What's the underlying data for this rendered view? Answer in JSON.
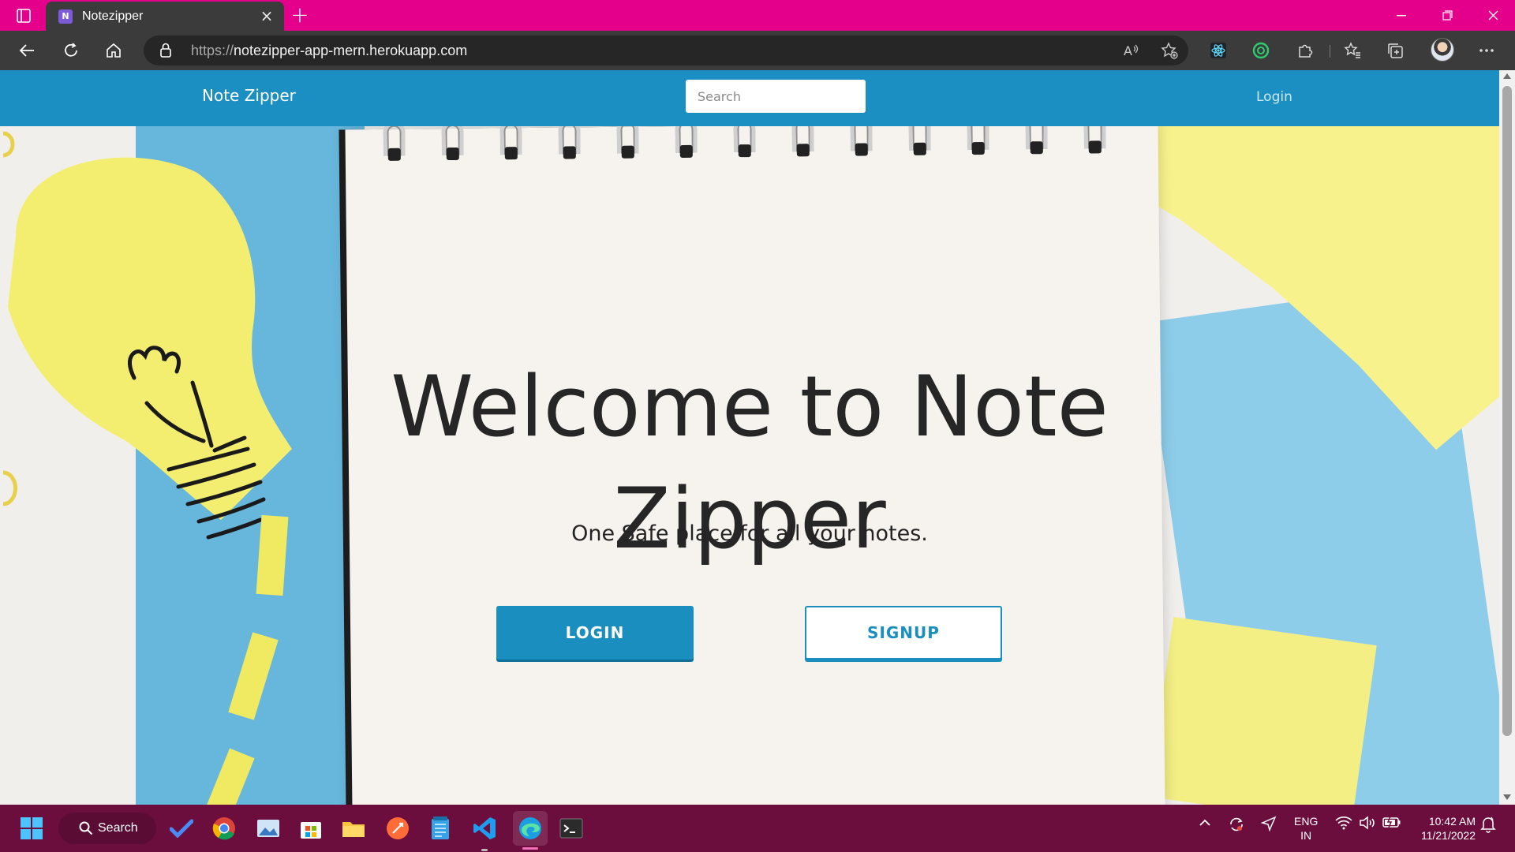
{
  "browser": {
    "tab_title": "Notezipper",
    "url_scheme": "https://",
    "url_host": "notezipper-app-mern.herokuapp.com"
  },
  "site": {
    "brand": "Note Zipper",
    "search_placeholder": "Search",
    "nav_login": "Login",
    "hero_title": "Welcome to Note Zipper",
    "hero_subtitle": "One Safe place for all your notes.",
    "login_button": "LOGIN",
    "signup_button": "SIGNUP",
    "colors": {
      "primary": "#1b8fc2",
      "tabstrip": "#e5008c",
      "taskbar": "#6b0e3e"
    }
  },
  "taskbar": {
    "search_label": "Search",
    "lang_line1": "ENG",
    "lang_line2": "IN",
    "time": "10:42 AM",
    "date": "11/21/2022",
    "apps": [
      "windows-start-icon",
      "todo-icon",
      "chrome-icon",
      "photos-icon",
      "store-icon",
      "file-explorer-icon",
      "postman-icon",
      "notepad-icon",
      "vscode-icon",
      "edge-icon",
      "terminal-icon"
    ]
  }
}
